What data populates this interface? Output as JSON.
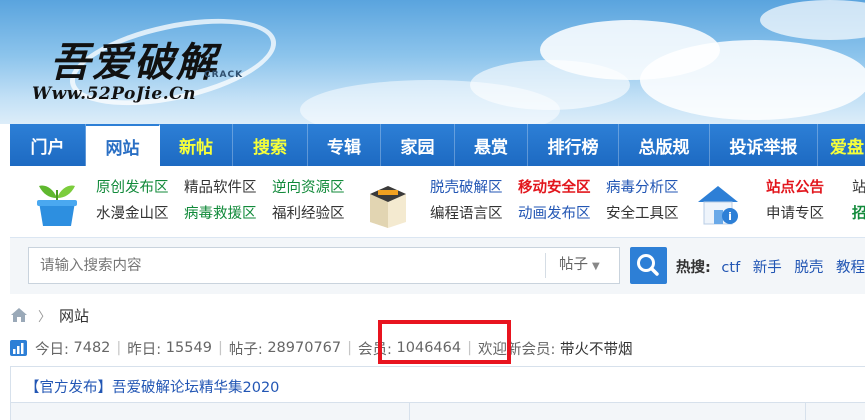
{
  "brand": {
    "name": "吾爱破解",
    "tag": "CRACK",
    "url": "Www.52PoJie.Cn"
  },
  "nav": [
    {
      "label": "门户",
      "state": "normal"
    },
    {
      "label": "网站",
      "state": "active"
    },
    {
      "label": "新帖",
      "state": "highlight"
    },
    {
      "label": "搜索",
      "state": "highlight"
    },
    {
      "label": "专辑",
      "state": "normal"
    },
    {
      "label": "家园",
      "state": "normal"
    },
    {
      "label": "悬赏",
      "state": "normal"
    },
    {
      "label": "排行榜",
      "state": "normal"
    },
    {
      "label": "总版规",
      "state": "normal"
    },
    {
      "label": "投诉举报",
      "state": "normal"
    },
    {
      "label": "爱盘",
      "state": "highlight"
    }
  ],
  "submenu": {
    "groups": [
      {
        "icon": "plant-icon",
        "rows": [
          [
            {
              "label": "原创发布区",
              "color": "green"
            },
            {
              "label": "精品软件区",
              "color": "dark"
            },
            {
              "label": "逆向资源区",
              "color": "green"
            }
          ],
          [
            {
              "label": "水漫金山区",
              "color": "dark"
            },
            {
              "label": "病毒救援区",
              "color": "green"
            },
            {
              "label": "福利经验区",
              "color": "dark"
            }
          ]
        ]
      },
      {
        "icon": "box-icon",
        "rows": [
          [
            {
              "label": "脱壳破解区",
              "color": "blue"
            },
            {
              "label": "移动安全区",
              "color": "red"
            },
            {
              "label": "病毒分析区",
              "color": "blue"
            }
          ],
          [
            {
              "label": "编程语言区",
              "color": "dark"
            },
            {
              "label": "动画发布区",
              "color": "blue"
            },
            {
              "label": "安全工具区",
              "color": "dark"
            }
          ]
        ]
      },
      {
        "icon": "house-icon",
        "rows": [
          [
            {
              "label": "站点公告",
              "color": "red"
            },
            {
              "label": "站",
              "color": "dark"
            }
          ],
          [
            {
              "label": "申请专区",
              "color": "dark"
            },
            {
              "label": "招",
              "color": "green"
            }
          ]
        ]
      }
    ]
  },
  "search": {
    "placeholder": "请输入搜索内容",
    "type_value": "帖子",
    "hot_label": "热搜:",
    "hot_keywords": [
      "ctf",
      "新手",
      "脱壳",
      "教程"
    ]
  },
  "breadcrumb": {
    "current": "网站"
  },
  "stats": {
    "today_label": "今日:",
    "today": "7482",
    "yesterday_label": "昨日:",
    "yesterday": "15549",
    "posts_label": "帖子:",
    "posts": "28970767",
    "members_label": "会员:",
    "members": "1046464",
    "welcome_label": "欢迎新会员:",
    "newest_member": "带火不带烟"
  },
  "announcement": "【官方发布】吾爱破解论坛精华集2020",
  "colors": {
    "nav_bg": "#1d6ac2",
    "nav_highlight": "#f6ff3a",
    "link_blue": "#2256b4",
    "green": "#118a3a",
    "red": "#e2161d",
    "annotation_red": "#e8141f"
  }
}
